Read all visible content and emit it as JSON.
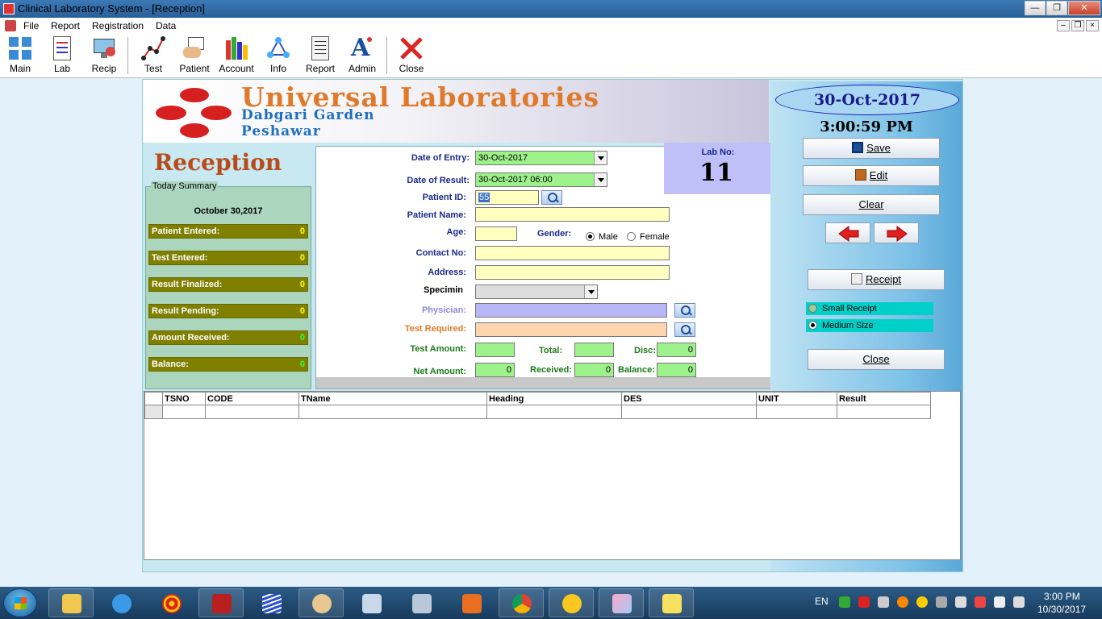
{
  "window": {
    "title": "Clinical Laboratory System - [Reception]",
    "controls": [
      "—",
      "❐",
      "✕"
    ],
    "mdi_controls": [
      "–",
      "❐",
      "×"
    ]
  },
  "menu": [
    "File",
    "Report",
    "Registration",
    "Data"
  ],
  "toolbar": [
    {
      "label": "Main",
      "icon": "main-grid-icon"
    },
    {
      "label": "Lab",
      "icon": "lab-document-icon"
    },
    {
      "label": "Recip",
      "icon": "recip-monitor-icon"
    },
    {
      "label": "Test",
      "icon": "test-chart-icon"
    },
    {
      "label": "Patient",
      "icon": "patient-hand-icon"
    },
    {
      "label": "Account",
      "icon": "account-books-icon"
    },
    {
      "label": "Info",
      "icon": "info-network-icon"
    },
    {
      "label": "Report",
      "icon": "report-page-icon"
    },
    {
      "label": "Admin",
      "icon": "admin-letter-icon"
    },
    {
      "label": "Close",
      "icon": "close-x-icon"
    }
  ],
  "header": {
    "brand": "Universal Laboratories",
    "line1": "Dabgari Garden",
    "line2": "Peshawar"
  },
  "page_title": "Reception",
  "summary": {
    "legend": "Today Summary",
    "date": "October 30,2017",
    "rows": [
      {
        "label": "Patient Entered:",
        "value": "0"
      },
      {
        "label": "Test Entered:",
        "value": "0"
      },
      {
        "label": "Result Finalized:",
        "value": "0"
      },
      {
        "label": "Result Pending:",
        "value": "0"
      },
      {
        "label": "Amount Received:",
        "value": "0"
      },
      {
        "label": "Balance:",
        "value": "0"
      }
    ]
  },
  "form": {
    "date_of_entry": {
      "label": "Date of Entry:",
      "value": "30-Oct-2017"
    },
    "date_of_result": {
      "label": "Date of Result:",
      "value": "30-Oct-2017 06:00"
    },
    "patient_id": {
      "label": "Patient ID:",
      "value": "55"
    },
    "patient_name": {
      "label": "Patient Name:",
      "value": ""
    },
    "age": {
      "label": "Age:",
      "value": ""
    },
    "gender": {
      "label": "Gender:",
      "options": [
        "Male",
        "Female"
      ],
      "selected": "Male"
    },
    "contact_no": {
      "label": "Contact No:",
      "value": ""
    },
    "address": {
      "label": "Address:",
      "value": ""
    },
    "specimen": {
      "label": "Specimin",
      "value": ""
    },
    "physician": {
      "label": "Physician:",
      "value": ""
    },
    "test_required": {
      "label": "Test Required:",
      "value": ""
    },
    "test_amount": {
      "label": "Test Amount:",
      "value": ""
    },
    "total": {
      "label": "Total:",
      "value": ""
    },
    "disc": {
      "label": "Disc:",
      "value": "0"
    },
    "net_amount": {
      "label": "Net Amount:",
      "value": "0"
    },
    "received": {
      "label": "Received:",
      "value": "0"
    },
    "balance": {
      "label": "Balance:",
      "value": "0"
    }
  },
  "lab_no": {
    "label": "Lab No:",
    "value": "11"
  },
  "side": {
    "date": "30-Oct-2017",
    "time": "3:00:59 PM",
    "save": "Save",
    "edit": "Edit",
    "clear": "Clear",
    "receipt": "Receipt",
    "receipt_options": [
      "Small Receipt",
      "Medium Size"
    ],
    "receipt_selected": "Medium Size",
    "close": "Close"
  },
  "grid": {
    "columns": [
      "TSNO",
      "CODE",
      "TName",
      "Heading",
      "DES",
      "UNIT",
      "Result"
    ]
  },
  "taskbar": {
    "lang": "EN",
    "time": "3:00 PM",
    "date": "10/30/2017"
  },
  "colors": {
    "accent_orange": "#e07a2a",
    "brand_blue": "#1e6fc0",
    "summary_row": "#7f7f00",
    "field_yellow": "#ffffc0",
    "field_green": "#9ef28c"
  }
}
